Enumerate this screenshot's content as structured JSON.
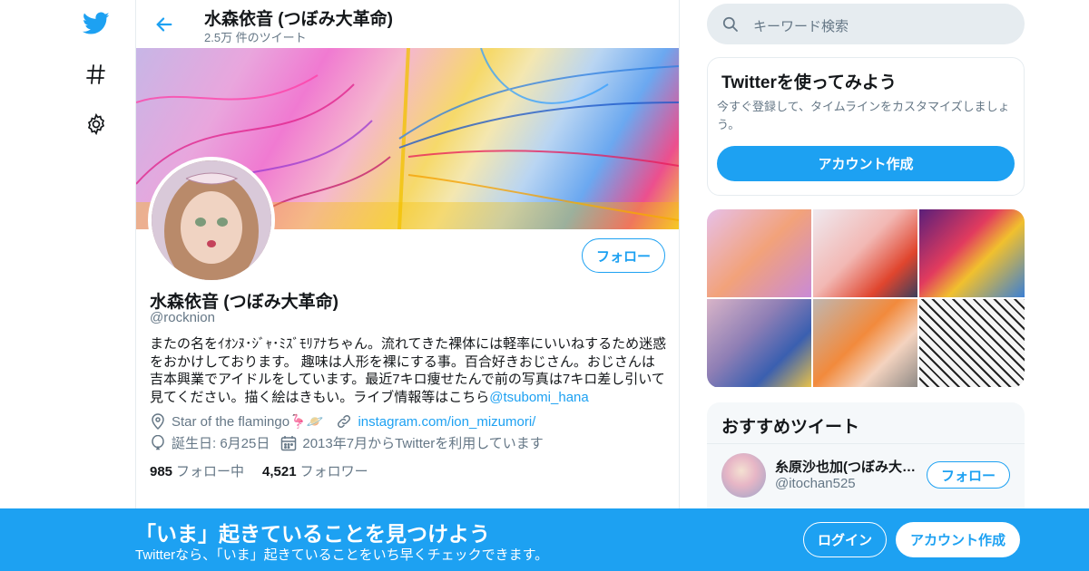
{
  "app": {
    "brand_color": "#1da1f2",
    "logo_icon": "twitter-bird-icon"
  },
  "leftnav": {
    "items": [
      {
        "icon": "twitter-bird-icon"
      },
      {
        "icon": "hashtag-icon"
      },
      {
        "icon": "gear-icon"
      }
    ]
  },
  "header": {
    "name": "水森依音 (つぼみ大革命)",
    "tweet_count": "2.5万 件のツイート"
  },
  "profile": {
    "follow_label": "フォロー",
    "name": "水森依音 (つぼみ大革命)",
    "handle": "@rocknion",
    "bio_text": "またの名をｲｵﾝﾇ･ｼﾞｬ･ﾐｽﾞﾓﾘｱﾅちゃん。流れてきた裸体には軽率にいいねするため迷惑をおかけしております。 趣味は人形を裸にする事。百合好きおじさん。おじさんは吉本興業でアイドルをしています。最近7キロ痩せたんで前の写真は7キロ差し引いて見てください。描く絵はきもい。ライブ情報等はこちら",
    "bio_link": "@tsubomi_hana",
    "location": "Star of the flamingo🦩🪐",
    "website": "instagram.com/ion_mizumori/",
    "birthday": "誕生日: 6月25日",
    "joined": "2013年7月からTwitterを利用しています",
    "following_count": "985",
    "following_label": "フォロー中",
    "followers_count": "4,521",
    "followers_label": "フォロワー"
  },
  "sidebar": {
    "search_placeholder": "キーワード検索",
    "signup_card": {
      "title": "Twitterを使ってみよう",
      "description": "今すぐ登録して、タイムラインをカスタマイズしましょう。",
      "button": "アカウント作成"
    },
    "recommended": {
      "title": "おすすめツイート",
      "users": [
        {
          "name": "糸原沙也加(つぼみ大革命)",
          "handle": "@itochan525",
          "follow_label": "フォロー"
        }
      ]
    }
  },
  "bottom_bar": {
    "title": "「いま」起きていることを見つけよう",
    "subtitle": "Twitterなら、「いま」起きていることをいち早くチェックできます。",
    "login": "ログイン",
    "signup": "アカウント作成"
  }
}
